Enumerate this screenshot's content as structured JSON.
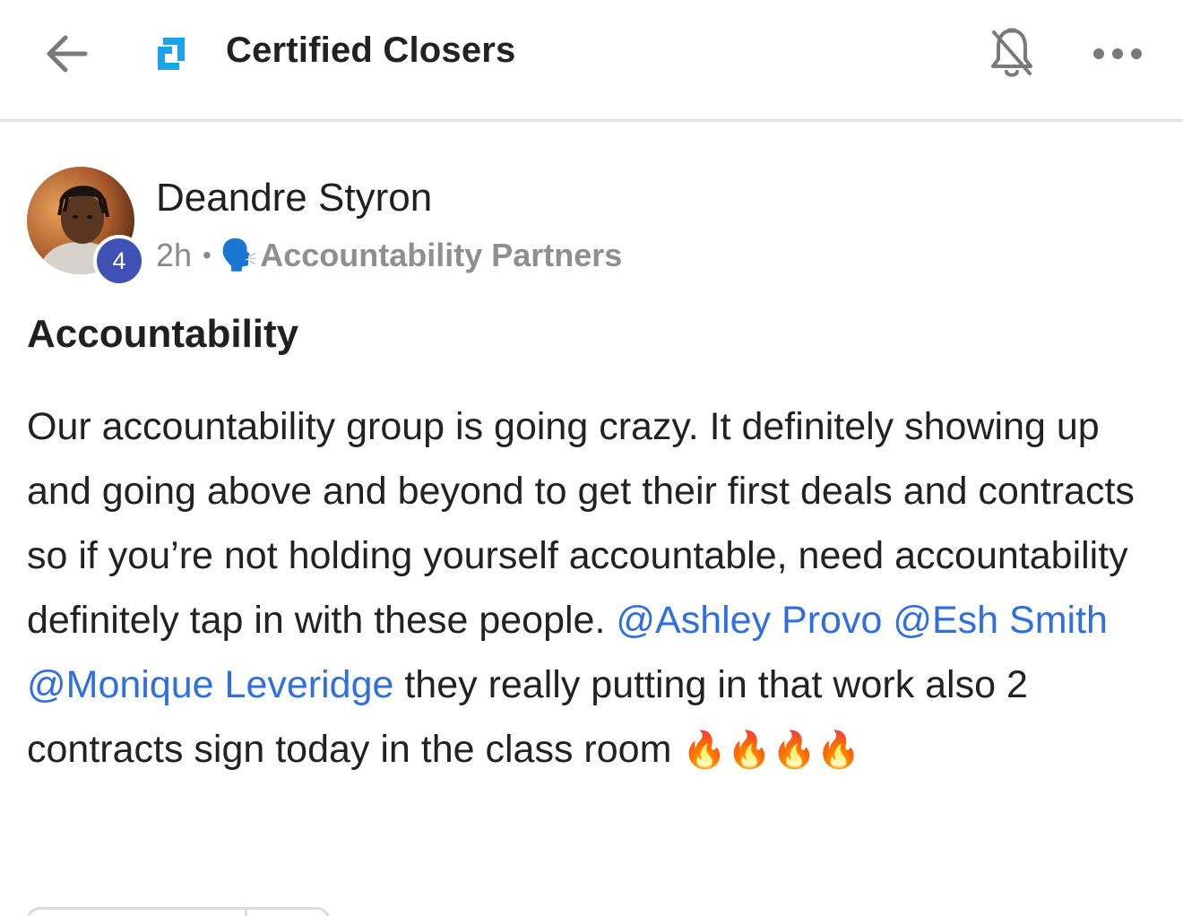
{
  "header": {
    "title": "Certified Closers",
    "icons": {
      "back": "back-arrow-icon",
      "logo": "app-logo-icon",
      "notifications": "bell-muted-icon",
      "more": "more-horizontal-icon"
    }
  },
  "post": {
    "author": "Deandre Styron",
    "level": "4",
    "time": "2h",
    "separator": "•",
    "category_emoji": "🗣️",
    "category": "Accountability Partners",
    "title": "Accountability",
    "body_part1": "Our accountability group is going crazy. It definitely showing up and going above and beyond to get their first deals and contracts so if you’re not holding yourself accountable, need accountability definitely tap in with these people. ",
    "mentions": [
      "@Ashley Provo",
      "@Esh Smith",
      "@Monique Leveridge"
    ],
    "body_part2": " they really putting in that work also 2 contracts sign today in the class room ",
    "emoji_tail": "🔥🔥🔥🔥"
  },
  "colors": {
    "accent": "#2f6fe0",
    "badge": "#3f51b5",
    "logo": "#1aa3e8",
    "muted_text": "#8a8a8a",
    "divider": "#e4e4e4"
  }
}
